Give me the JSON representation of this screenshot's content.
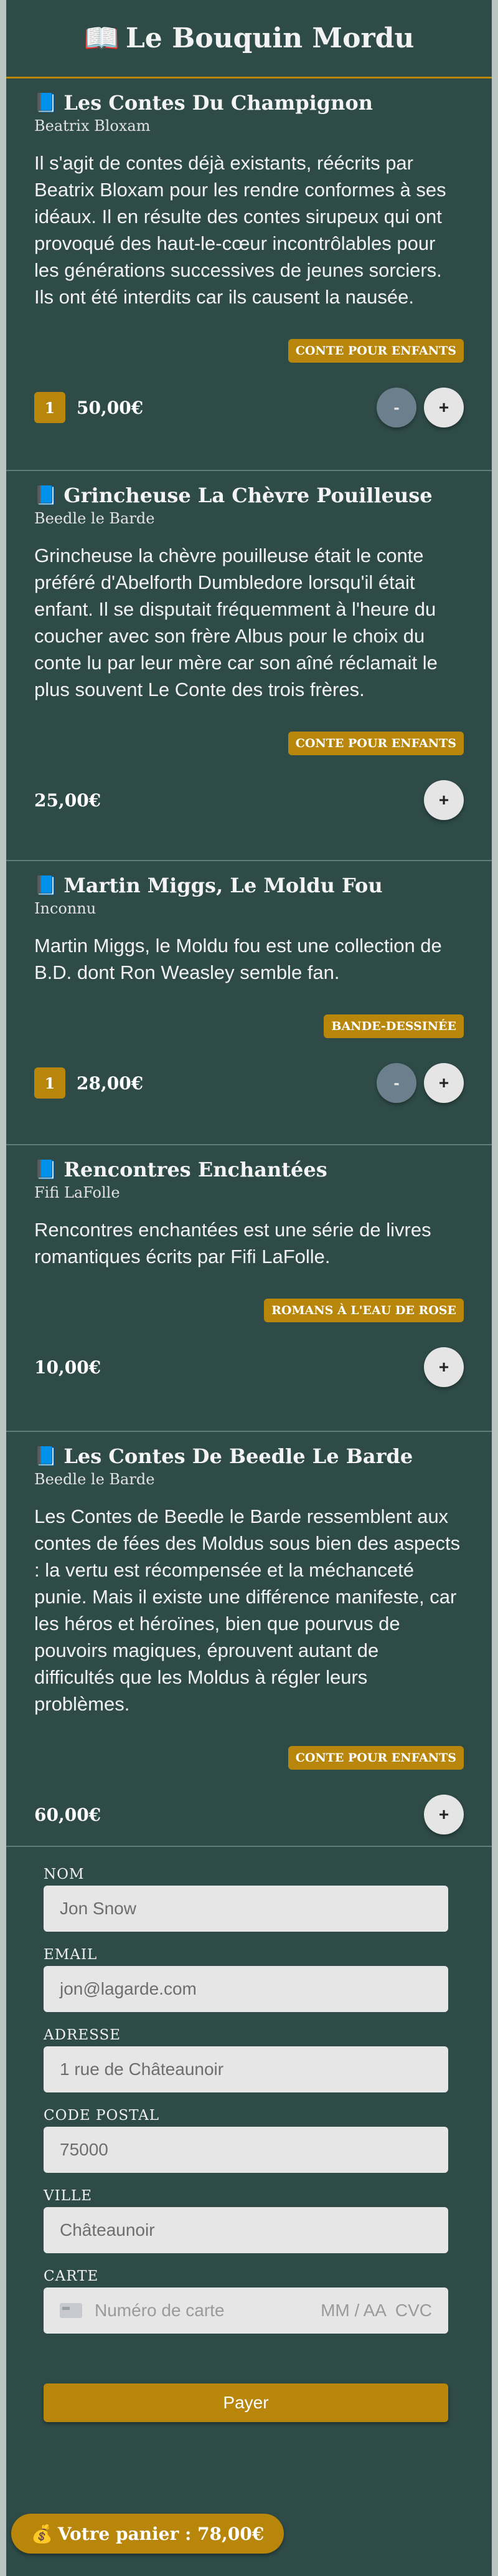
{
  "app": {
    "title": "Le Bouquin Mordu",
    "logo_icon": "open-book-icon"
  },
  "colors": {
    "background": "#2e4b48",
    "accent": "#b8860b",
    "page": "#b9c3c0"
  },
  "products": [
    {
      "title": "Les Contes Du Champignon",
      "author": "Beatrix Bloxam",
      "description": "Il s'agit de contes déjà existants, réécrits par Beatrix Bloxam pour les rendre conformes à ses idéaux. Il en résulte des contes sirupeux qui ont provoqué des haut-le-cœur incontrôlables pour les générations successives de jeunes sorciers. Ils ont été interdits car ils causent la nausée.",
      "tag": "CONTE POUR ENFANTS",
      "quantity": "1",
      "price": "50,00€",
      "minus_label": "-",
      "plus_label": "+"
    },
    {
      "title": "Grincheuse La Chèvre Pouilleuse",
      "author": "Beedle le Barde",
      "description": "Grincheuse la chèvre pouilleuse était le conte préféré d'Abelforth Dumbledore lorsqu'il était enfant. Il se disputait fréquemment à l'heure du coucher avec son frère Albus pour le choix du conte lu par leur mère car son aîné réclamait le plus souvent Le Conte des trois frères.",
      "tag": "CONTE POUR ENFANTS",
      "price": "25,00€",
      "plus_label": "+"
    },
    {
      "title": "Martin Miggs, Le Moldu Fou",
      "author": "Inconnu",
      "description": "Martin Miggs, le Moldu fou est une collection de B.D. dont Ron Weasley semble fan.",
      "tag": "BANDE-DESSINÉE",
      "quantity": "1",
      "price": "28,00€",
      "minus_label": "-",
      "plus_label": "+"
    },
    {
      "title": "Rencontres Enchantées",
      "author": "Fifi LaFolle",
      "description": "Rencontres enchantées est une série de livres romantiques écrits par Fifi LaFolle.",
      "tag": "ROMANS À L'EAU DE ROSE",
      "price": "10,00€",
      "plus_label": "+"
    },
    {
      "title": "Les Contes De Beedle Le Barde",
      "author": "Beedle le Barde",
      "description": "Les Contes de Beedle le Barde ressemblent aux contes de fées des Moldus sous bien des aspects : la vertu est récompensée et la méchanceté punie. Mais il existe une différence manifeste, car les héros et héroïnes, bien que pourvus de pouvoirs magiques, éprouvent autant de difficultés que les Moldus à régler leurs problèmes.",
      "tag": "CONTE POUR ENFANTS",
      "price": "60,00€",
      "plus_label": "+"
    }
  ],
  "form": {
    "name": {
      "label": "NOM",
      "placeholder": "Jon Snow"
    },
    "email": {
      "label": "EMAIL",
      "placeholder": "jon@lagarde.com"
    },
    "address": {
      "label": "ADRESSE",
      "placeholder": "1 rue de Châteaunoir"
    },
    "postal": {
      "label": "CODE POSTAL",
      "placeholder": "75000"
    },
    "city": {
      "label": "VILLE",
      "placeholder": "Châteaunoir"
    },
    "card": {
      "label": "CARTE",
      "number_placeholder": "Numéro de carte",
      "expiry_placeholder": "MM / AA",
      "cvc_placeholder": "CVC",
      "icon": "credit-card-icon"
    },
    "pay_label": "Payer"
  },
  "cart": {
    "label": "Votre panier : 78,00€",
    "icon": "money-bag-icon"
  }
}
